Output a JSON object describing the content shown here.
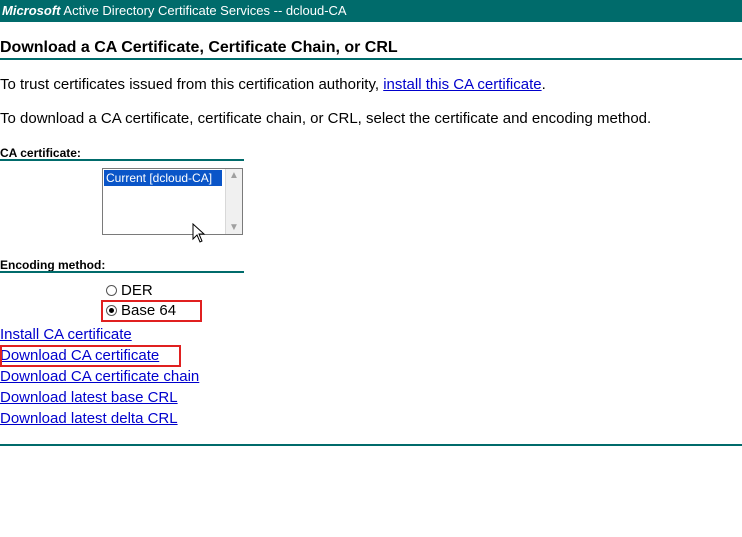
{
  "window": {
    "brand": "Microsoft",
    "title": "Active Directory Certificate Services  --  dcloud-CA"
  },
  "page": {
    "heading": "Download a CA Certificate, Certificate Chain, or CRL",
    "trust_text": "To trust certificates issued from this certification authority, ",
    "trust_link": "install this CA certificate",
    "trust_end": ".",
    "instruction": "To download a CA certificate, certificate chain, or CRL, select the certificate and encoding method."
  },
  "ca_certificate": {
    "label": "CA certificate:",
    "options": [
      "Current [dcloud-CA]"
    ]
  },
  "encoding": {
    "label": "Encoding method:",
    "options": [
      {
        "label": "DER",
        "selected": false
      },
      {
        "label": "Base 64",
        "selected": true
      }
    ]
  },
  "links": [
    "Install CA certificate",
    "Download CA certificate",
    "Download CA certificate chain",
    "Download latest base CRL",
    "Download latest delta CRL"
  ],
  "colors": {
    "banner": "#006b6b",
    "link": "#0000cc",
    "highlight": "#e02020",
    "selection": "#0a55c8"
  },
  "icons": {
    "scroll_up": "triangle-up",
    "scroll_down": "triangle-down",
    "cursor": "mouse-pointer-arrow"
  }
}
